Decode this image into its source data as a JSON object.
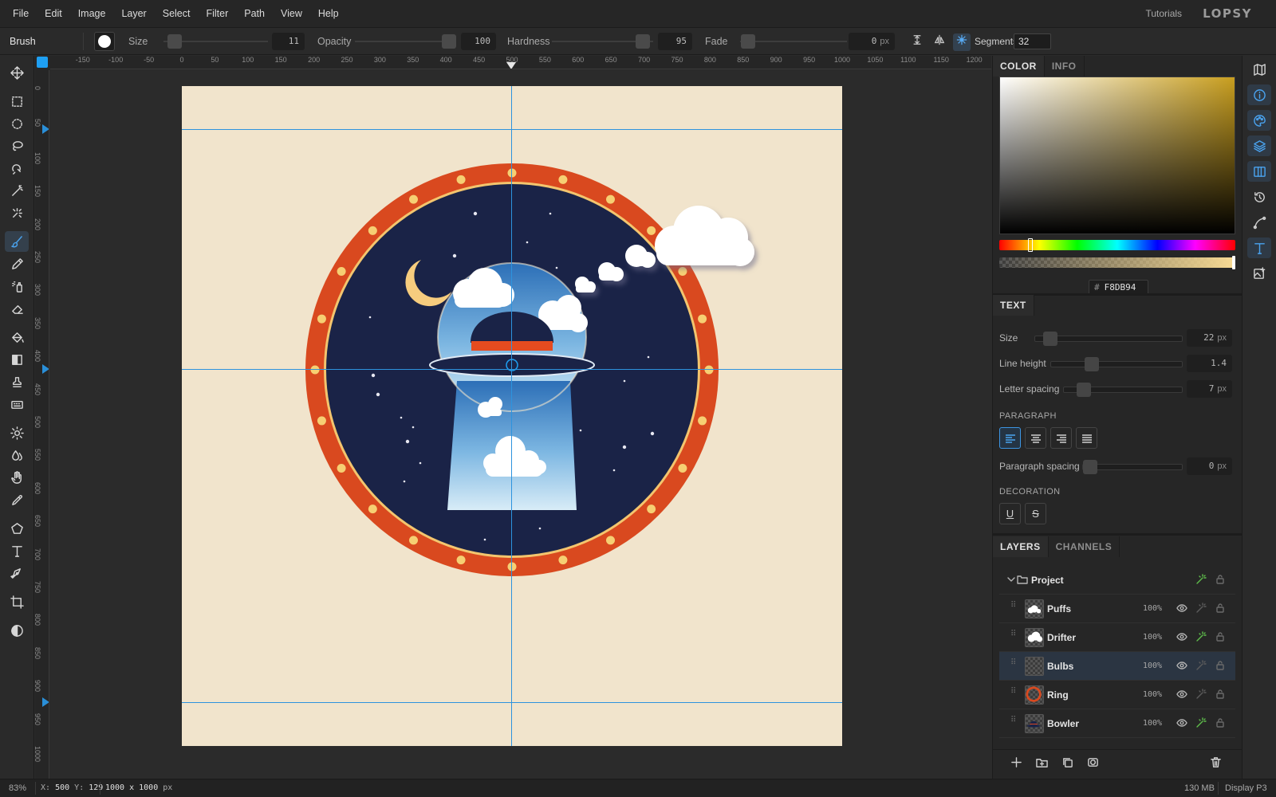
{
  "menu": {
    "items": [
      "File",
      "Edit",
      "Image",
      "Layer",
      "Select",
      "Filter",
      "Path",
      "View",
      "Help"
    ],
    "tutorials": "Tutorials",
    "logo": "LOPSY"
  },
  "options": {
    "tool": "Brush",
    "size_label": "Size",
    "size_value": "11",
    "opacity_label": "Opacity",
    "opacity_value": "100",
    "hardness_label": "Hardness",
    "hardness_value": "95",
    "fade_label": "Fade",
    "fade_value": "0",
    "fade_unit": "px",
    "segments_label": "Segments",
    "segments_value": "32"
  },
  "ruler": {
    "top": [
      "-150",
      "-100",
      "-50",
      "0",
      "50",
      "100",
      "150",
      "200",
      "250",
      "300",
      "350",
      "400",
      "450",
      "500",
      "550",
      "600",
      "650",
      "700",
      "750",
      "800",
      "850",
      "900",
      "950",
      "1000",
      "1050",
      "1100",
      "1150",
      "1200"
    ],
    "left": [
      "0",
      "50",
      "100",
      "150",
      "200",
      "250",
      "300",
      "350",
      "400",
      "450",
      "500",
      "550",
      "600",
      "650",
      "700",
      "750",
      "800",
      "850",
      "900",
      "950",
      "1000"
    ]
  },
  "color_panel": {
    "tabs": [
      "COLOR",
      "INFO"
    ],
    "hex": "F8DB94",
    "hash": "#"
  },
  "text_panel": {
    "tab": "TEXT",
    "size_label": "Size",
    "size_value": "22",
    "size_unit": "px",
    "line_height_label": "Line height",
    "line_height_value": "1.4",
    "letter_spacing_label": "Letter spacing",
    "letter_spacing_value": "7",
    "letter_spacing_unit": "px",
    "paragraph_heading": "PARAGRAPH",
    "paragraph_spacing_label": "Paragraph spacing",
    "paragraph_spacing_value": "0",
    "paragraph_spacing_unit": "px",
    "decoration_heading": "DECORATION",
    "underline": "U",
    "strike": "S"
  },
  "layers_panel": {
    "tabs": [
      "LAYERS",
      "CHANNELS"
    ],
    "folder": "Project",
    "layers": [
      {
        "name": "Puffs",
        "opacity": "100%",
        "fx": false
      },
      {
        "name": "Drifter",
        "opacity": "100%",
        "fx": true
      },
      {
        "name": "Bulbs",
        "opacity": "100%",
        "fx": false,
        "selected": true
      },
      {
        "name": "Ring",
        "opacity": "100%",
        "fx": false
      },
      {
        "name": "Bowler",
        "opacity": "100%",
        "fx": true
      }
    ]
  },
  "status": {
    "zoom": "83%",
    "x_label": "X:",
    "x": "500",
    "y_label": "Y:",
    "y": "129",
    "dims": "1000 x 1000",
    "dims_unit": "px",
    "memory": "130 MB",
    "display": "Display P3"
  },
  "colors": {
    "accent": "#1e9ff2",
    "canvas_bg": "#f1e4cc",
    "ring": "#d9491f",
    "night": "#1a2347",
    "fx_green": "#5fbf4b"
  }
}
